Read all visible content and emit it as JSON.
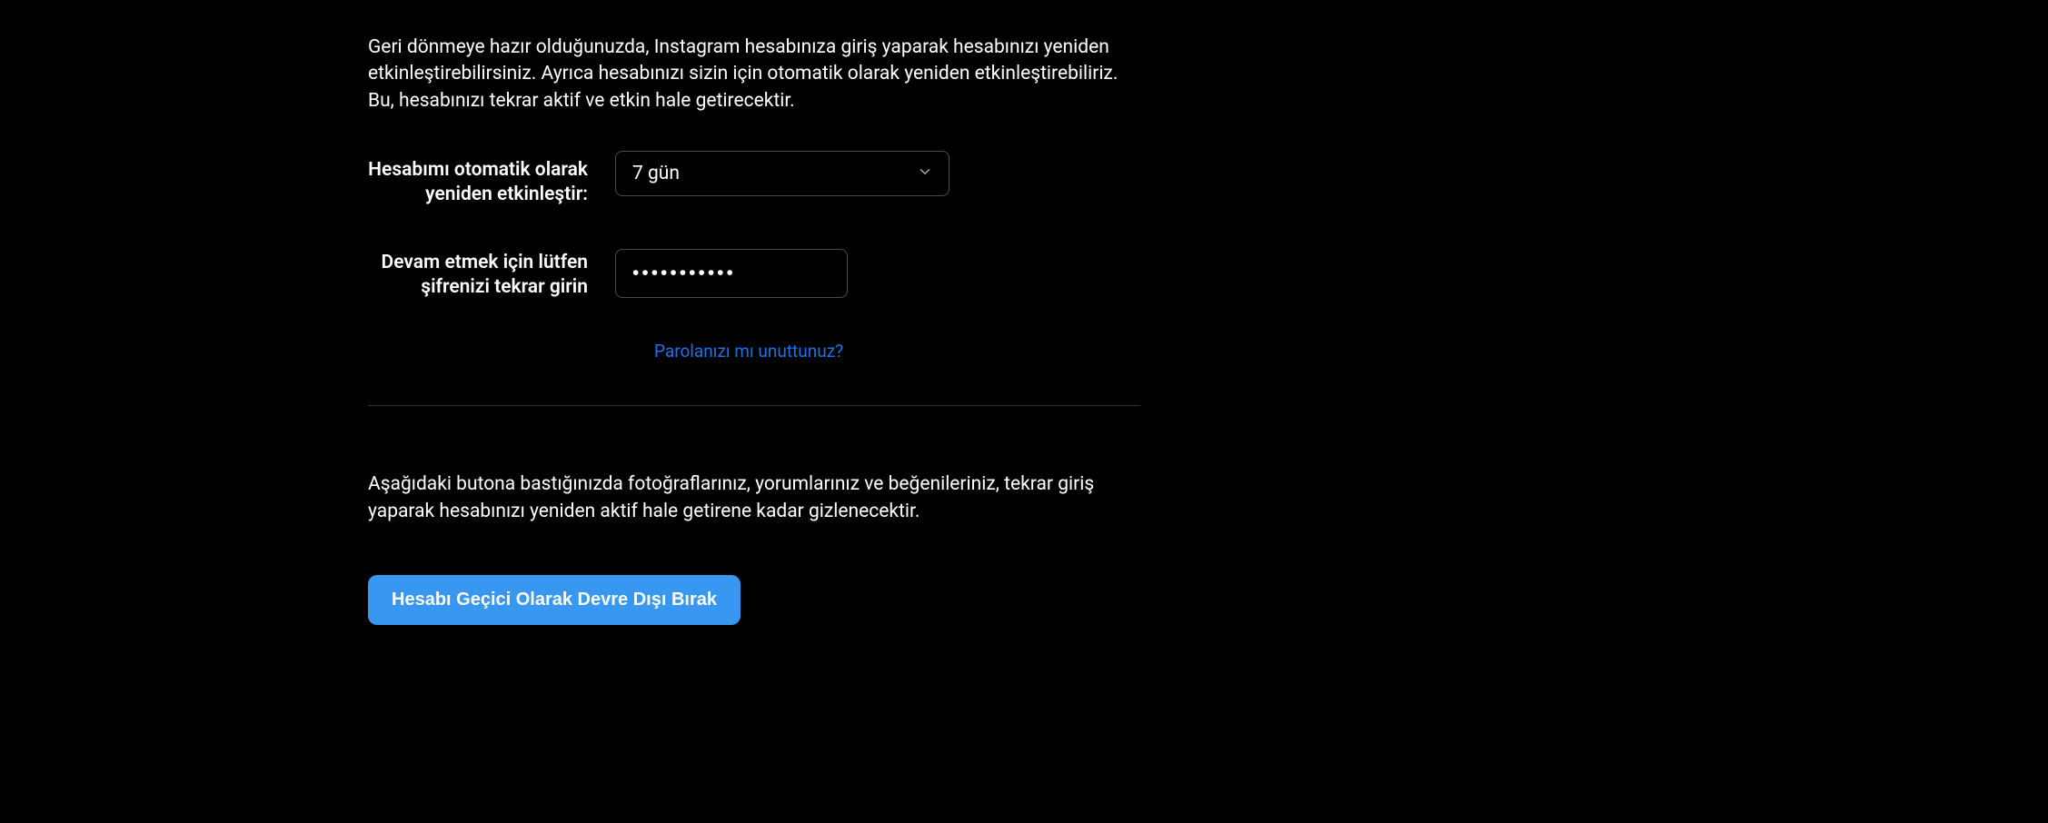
{
  "intro_text": "Geri dönmeye hazır olduğunuzda, Instagram hesabınıza giriş yaparak hesabınızı yeniden etkinleştirebilirsiniz. Ayrıca hesabınızı sizin için otomatik olarak yeniden etkinleştirebiliriz. Bu, hesabınızı tekrar aktif ve etkin hale getirecektir.",
  "reactivate": {
    "label": "Hesabımı otomatik olarak yeniden etkinleştir:",
    "selected_value": "7 gün"
  },
  "password": {
    "label": "Devam etmek için lütfen şifrenizi tekrar girin",
    "value": "•••••••••••"
  },
  "forgot_password_link": "Parolanızı mı unuttunuz?",
  "info_text": "Aşağıdaki butona bastığınızda fotoğraflarınız, yorumlarınız ve beğenileriniz, tekrar giriş yaparak hesabınızı yeniden aktif hale getirene kadar gizlenecektir.",
  "deactivate_button": "Hesabı Geçici Olarak Devre Dışı Bırak"
}
